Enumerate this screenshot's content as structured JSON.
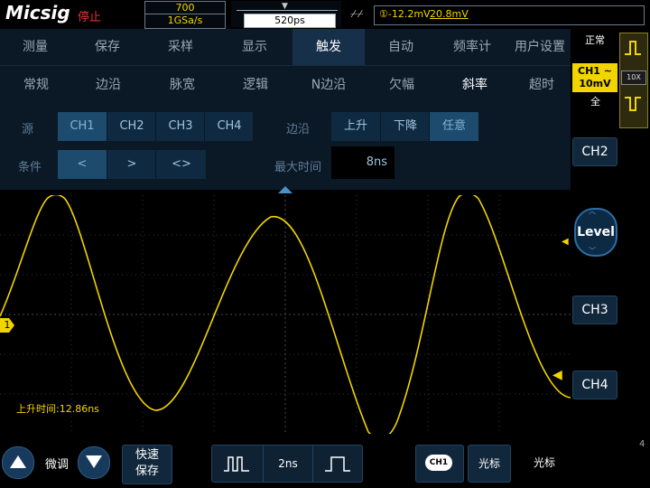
{
  "header": {
    "logo": "Micsig",
    "run_state": "停止",
    "memory_depth": "700",
    "sample_rate": "1GSa/s",
    "timebase": "520ps",
    "trigger_channel": "①-12.2mV",
    "trigger_level": "20.8mV"
  },
  "menu_main": {
    "items": [
      "测量",
      "保存",
      "采样",
      "显示",
      "触发",
      "自动",
      "频率计",
      "用户设置"
    ],
    "active": "触发"
  },
  "menu_trigger_types": {
    "items": [
      "常规",
      "边沿",
      "脉宽",
      "逻辑",
      "N边沿",
      "欠幅",
      "斜率",
      "超时"
    ],
    "active": "斜率"
  },
  "config": {
    "source_label": "源",
    "source_options": [
      "CH1",
      "CH2",
      "CH3",
      "CH4"
    ],
    "source_selected": "CH1",
    "edge_label": "边沿",
    "edge_options": [
      "上升",
      "下降",
      "任意"
    ],
    "edge_selected": "任意",
    "condition_label": "条件",
    "condition_options": [
      "<",
      ">",
      "<>"
    ],
    "condition_selected": "<",
    "max_time_label": "最大时间",
    "max_time_value": "8ns"
  },
  "waveform": {
    "channel_marker": "1",
    "rise_time_text": "上升时间:12.86ns",
    "trace_color": "#f2d400"
  },
  "right_panel": {
    "mode": "正常",
    "ch1_label": "CH1",
    "ch1_scale": "10mV",
    "ch1_coupling_icon": "~",
    "probe_ratio": "10X",
    "bandwidth": "全",
    "ch2_label": "CH2",
    "level_label": "Level",
    "ch3_label": "CH3",
    "ch4_label": "CH4"
  },
  "bottom": {
    "fine_label": "微调",
    "quick_save_line1": "快速",
    "quick_save_line2": "保存",
    "timebase_value": "2ns",
    "ch1_button": "CH1",
    "cursor_label1": "光标",
    "cursor_label2": "光标",
    "edge_number": "4"
  },
  "colors": {
    "accent": "#f2d400",
    "panel_bg": "#0b1826",
    "active_tab": "#17304a",
    "button_bg": "#11283c"
  }
}
